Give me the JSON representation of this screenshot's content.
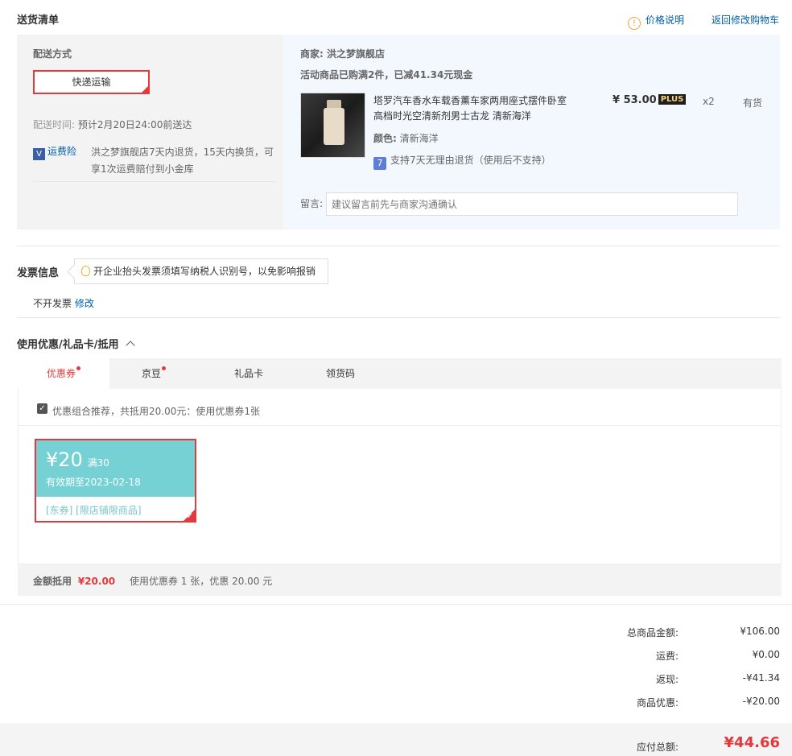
{
  "header": {
    "title": "送货清单",
    "price_explain": "价格说明",
    "back_to_cart": "返回修改购物车"
  },
  "delivery": {
    "method_label": "配送方式",
    "method_value": "快递运输",
    "time_label": "配送时间:",
    "time_value": "预计2月20日24:00前送达",
    "insurance_label": "运费险",
    "insurance_text_line1": "洪之梦旗舰店7天内退货，15天内换货，可",
    "insurance_text_line2": "享1次运费赔付到小金库"
  },
  "merchant": {
    "label": "商家:",
    "name": "洪之梦旗舰店",
    "promo": "活动商品已购满2件，已减41.34元现金"
  },
  "product": {
    "title_line1": "塔罗汽车香水车载香薰车家两用座式摆件卧室",
    "title_line2": "高档时光空清新剂男士古龙 清新海洋",
    "color_label": "颜色:",
    "color_value": "清新海洋",
    "return_policy": "支持7天无理由退货（使用后不支持）",
    "price": "¥ 53.00",
    "plus_tag": "PLUS",
    "qty": "x2",
    "stock": "有货",
    "return_icon_glyph": "7"
  },
  "message": {
    "label": "留言:",
    "placeholder": "建议留言前先与商家沟通确认"
  },
  "invoice": {
    "title": "发票信息",
    "tip": "开企业抬头发票须填写纳税人识别号，以免影响报销",
    "status": "不开发票",
    "edit": "修改"
  },
  "discounts": {
    "title": "使用优惠/礼品卡/抵用",
    "tabs": [
      {
        "label": "优惠券",
        "dot": true
      },
      {
        "label": "京豆",
        "dot": true
      },
      {
        "label": "礼品卡",
        "dot": false
      },
      {
        "label": "领货码",
        "dot": false
      }
    ],
    "recommend_text": "优惠组合推荐，共抵用20.00元：使用优惠券1张",
    "coupon": {
      "amount": "¥20",
      "condition": "满30",
      "validity": "有效期至2023-02-18",
      "tags": "[东券] [限店铺限商品]"
    },
    "summary_label": "金额抵用",
    "summary_amount": "¥20.00",
    "summary_detail": "使用优惠券 1 张，优惠 20.00 元"
  },
  "totals": {
    "goods_label": "总商品金额:",
    "goods_value": "¥106.00",
    "shipping_label": "运费:",
    "shipping_value": "¥0.00",
    "rebate_label": "返现:",
    "rebate_value": "-¥41.34",
    "discount_label": "商品优惠:",
    "discount_value": "-¥20.00",
    "payable_label": "应付总额:",
    "payable_value": "¥44.66"
  },
  "colors": {
    "accent_red": "#e4393c",
    "link_blue": "#005ea7",
    "coupon_teal": "#76d1d5",
    "panel_gray": "#f3f3f3",
    "panel_blue": "#f3f8fe"
  }
}
